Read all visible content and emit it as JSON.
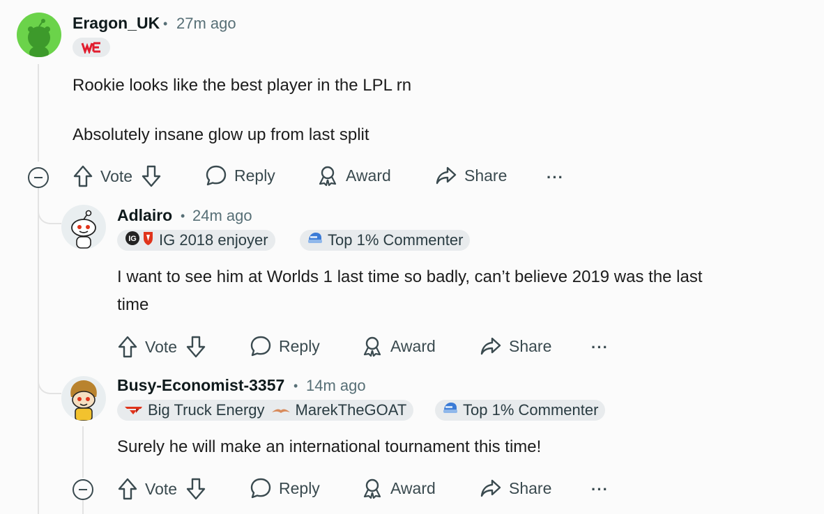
{
  "comments": [
    {
      "username": "Eragon_UK",
      "time": "27m ago",
      "flairs": [
        {
          "text": "",
          "icon": "we-team-logo-icon"
        }
      ],
      "body": [
        "Rookie looks like the best player in the LPL rn",
        "Absolutely insane glow up from last split"
      ],
      "actions": {
        "vote": "Vote",
        "reply": "Reply",
        "award": "Award",
        "share": "Share",
        "more": "···"
      }
    },
    {
      "username": "Adlairo",
      "time": "24m ago",
      "flairs": [
        {
          "text": "IG 2018 enjoyer",
          "icon": "ig-team-logo-icon"
        },
        {
          "text": "Top 1% Commenter",
          "icon": "top-commenter-icon"
        }
      ],
      "body": [
        "I want to see him at Worlds 1 last time so badly, can’t believe 2019 was the last",
        "time"
      ],
      "actions": {
        "vote": "Vote",
        "reply": "Reply",
        "award": "Award",
        "share": "Share",
        "more": "···"
      }
    },
    {
      "username": "Busy-Economist-3357",
      "time": "14m ago",
      "flairs": [
        {
          "text": "Big Truck Energy",
          "icon": "tes-team-logo-icon",
          "text2": "MarekTheGOAT",
          "icon2": "mustache-icon"
        },
        {
          "text": "Top 1% Commenter",
          "icon": "top-commenter-icon"
        }
      ],
      "body": [
        "Surely he will make an international tournament this time!"
      ],
      "actions": {
        "vote": "Vote",
        "reply": "Reply",
        "award": "Award",
        "share": "Share",
        "more": "···"
      }
    }
  ],
  "separator": "•",
  "colors": {
    "meta": "#576f76",
    "flair_bg": "#e8ebed",
    "thread_line": "#e3e3e3",
    "avatar_green": "#6bd34a"
  }
}
